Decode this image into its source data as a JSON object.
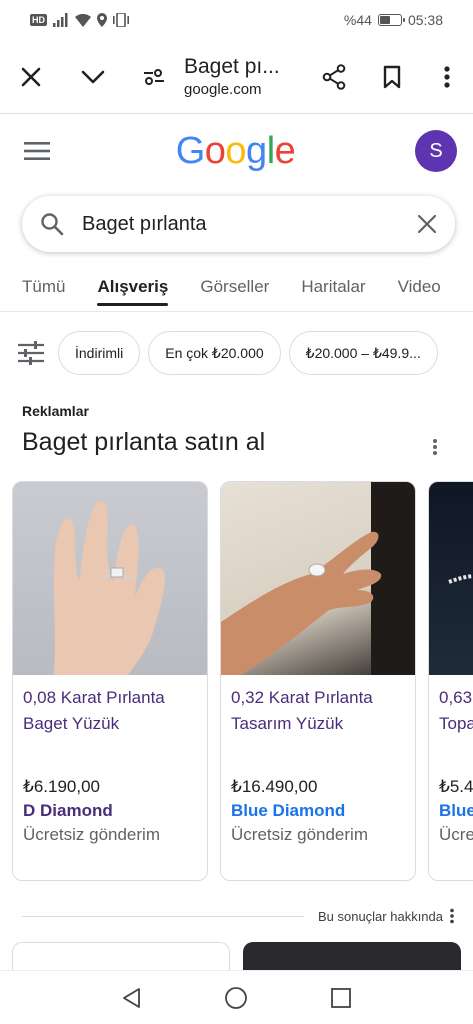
{
  "status_bar": {
    "network_badge": "HD",
    "battery": "%44",
    "battery_level": 0.44,
    "time": "05:38"
  },
  "toolbar": {
    "title": "Baget pı...",
    "url": "google.com"
  },
  "header": {
    "logo_letters": [
      "G",
      "o",
      "o",
      "g",
      "l",
      "e"
    ],
    "logo_colors": [
      "#4285F4",
      "#EA4335",
      "#FBBC05",
      "#4285F4",
      "#34A853",
      "#EA4335"
    ],
    "avatar_letter": "S",
    "avatar_color": "#5e35b1"
  },
  "search": {
    "value": "Baget pırlanta"
  },
  "tabs": [
    {
      "label": "Tümü",
      "active": false
    },
    {
      "label": "Alışveriş",
      "active": true
    },
    {
      "label": "Görseller",
      "active": false
    },
    {
      "label": "Haritalar",
      "active": false
    },
    {
      "label": "Video",
      "active": false
    }
  ],
  "chips": [
    {
      "label": "İndirimli"
    },
    {
      "label": "En çok ₺20.000"
    },
    {
      "label": "₺20.000 – ₺49.9..."
    }
  ],
  "ads": {
    "label": "Reklamlar",
    "title": "Baget pırlanta satın al",
    "products": [
      {
        "name": "0,08 Karat Pırlanta Baget Yüzük",
        "price": "₺6.190,00",
        "store": "D Diamond",
        "store_color": "#4a2d7b",
        "shipping": "Ücretsiz gönderim"
      },
      {
        "name": "0,32 Karat Pırlanta Tasarım Yüzük",
        "price": "₺16.490,00",
        "store": "Blue Diamond",
        "store_color": "#1a73e8",
        "shipping": "Ücretsiz gönderim"
      },
      {
        "name": "0,63 Topa",
        "price": "₺5.4",
        "store": "Blue",
        "store_color": "#1a73e8",
        "shipping": "Ücre"
      }
    ]
  },
  "about": {
    "label": "Bu sonuçlar hakkında"
  }
}
